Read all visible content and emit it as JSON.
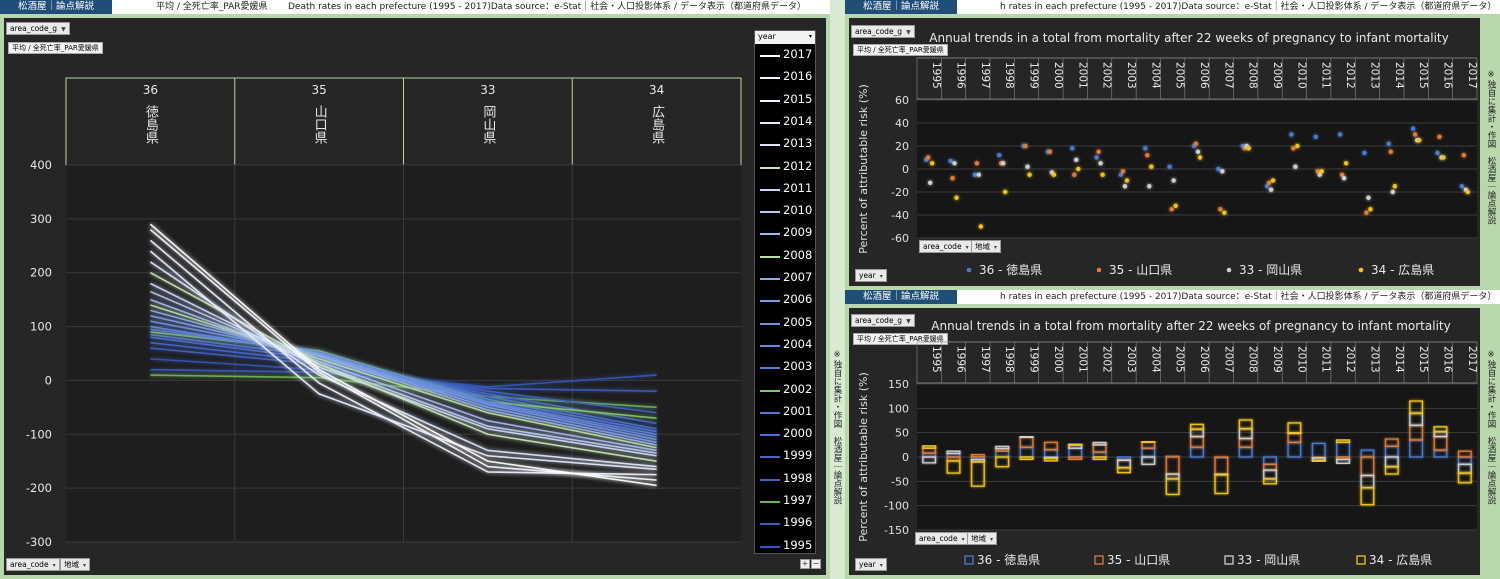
{
  "left": {
    "brand": "松酒屋｜論点解説",
    "crumb1": "平均 / 全死亡率_PAR愛媛県",
    "crumb2": "Death rates in each prefecture (1995 - 2017)Data source：e-Stat｜社会・人口投影体系 / データ表示（都道府県データ）",
    "filter_label": "area_code_g",
    "subtitle": "平均 / 全死亡率_PAR愛媛県",
    "legend_title": "year",
    "bottom_left": "area_code",
    "bottom_mid": "地域",
    "side_note": "※独自に集計・作図　松酒屋｜論点解説",
    "plus": "+",
    "minus": "−"
  },
  "right_top": {
    "brand": "松酒屋｜論点解説",
    "crumb": "h rates in each prefecture (1995 - 2017)Data source：e-Stat｜社会・人口投影体系 / データ表示（都道府県データ）",
    "filter_label": "area_code_g",
    "subtitle": "平均 / 全死亡率_PAR愛媛県",
    "area_code": "area_code",
    "area_region": "地域",
    "year_chip": "year",
    "side_note": "※独自に集計・作図　松酒屋｜論点解説"
  },
  "right_bottom": {
    "brand": "松酒屋｜論点解説",
    "crumb": "h rates in each prefecture (1995 - 2017)Data source：e-Stat｜社会・人口投影体系 / データ表示（都道府県データ）",
    "filter_label": "area_code_g",
    "subtitle": "平均 / 全死亡率_PAR愛媛県",
    "area_code": "area_code",
    "area_region": "地域",
    "year_chip": "year",
    "side_note": "※独自に集計・作図　松酒屋｜論点解説"
  },
  "colors": {
    "tokushima": "#4a7bd0",
    "yamaguchi": "#e07b39",
    "okayama": "#cfcfcf",
    "hiroshima": "#f0c419"
  },
  "chart_data": [
    {
      "type": "line",
      "title": "",
      "categories": [
        "36\n徳島県",
        "35\n山口県",
        "33\n岡山県",
        "34\n広島県"
      ],
      "category_codes": [
        "36",
        "35",
        "33",
        "34"
      ],
      "category_names": [
        "徳島県",
        "山口県",
        "岡山県",
        "広島県"
      ],
      "ylim": [
        -300,
        400
      ],
      "yticks": [
        -300,
        -200,
        -100,
        0,
        100,
        200,
        300,
        400
      ],
      "legend_position": "right",
      "legend_title": "year",
      "series": [
        {
          "name": "2017",
          "color": "#ffffff",
          "values": [
            290,
            20,
            -150,
            -195
          ]
        },
        {
          "name": "2016",
          "color": "#f4f7ff",
          "values": [
            280,
            15,
            -160,
            -185
          ]
        },
        {
          "name": "2015",
          "color": "#eef2ff",
          "values": [
            260,
            -5,
            -170,
            -175
          ]
        },
        {
          "name": "2014",
          "color": "#e6ecff",
          "values": [
            240,
            -25,
            -140,
            -165
          ]
        },
        {
          "name": "2013",
          "color": "#dde5fb",
          "values": [
            220,
            10,
            -130,
            -160
          ]
        },
        {
          "name": "2012",
          "color": "#c6e6b6",
          "values": [
            200,
            30,
            -100,
            -150
          ]
        },
        {
          "name": "2011",
          "color": "#cbd7f6",
          "values": [
            180,
            25,
            -90,
            -140
          ]
        },
        {
          "name": "2010",
          "color": "#b7c8f2",
          "values": [
            165,
            30,
            -85,
            -135
          ]
        },
        {
          "name": "2009",
          "color": "#a3b9ee",
          "values": [
            150,
            35,
            -75,
            -130
          ]
        },
        {
          "name": "2008",
          "color": "#b8df9f",
          "values": [
            140,
            40,
            -60,
            -125
          ]
        },
        {
          "name": "2007",
          "color": "#8ea9ea",
          "values": [
            130,
            45,
            -55,
            -120
          ]
        },
        {
          "name": "2006",
          "color": "#7f9de6",
          "values": [
            120,
            48,
            -50,
            -115
          ]
        },
        {
          "name": "2005",
          "color": "#6f91e2",
          "values": [
            110,
            50,
            -45,
            -110
          ]
        },
        {
          "name": "2004",
          "color": "#6488de",
          "values": [
            100,
            50,
            -42,
            -105
          ]
        },
        {
          "name": "2003",
          "color": "#5b80da",
          "values": [
            95,
            52,
            -40,
            -100
          ]
        },
        {
          "name": "2002",
          "color": "#86c66a",
          "values": [
            90,
            55,
            -40,
            -70
          ]
        },
        {
          "name": "2001",
          "color": "#5278d4",
          "values": [
            85,
            45,
            -35,
            -95
          ]
        },
        {
          "name": "2000",
          "color": "#4a70cf",
          "values": [
            80,
            40,
            -30,
            -90
          ]
        },
        {
          "name": "1999",
          "color": "#4469c9",
          "values": [
            70,
            35,
            -25,
            -80
          ]
        },
        {
          "name": "1998",
          "color": "#3f63c4",
          "values": [
            60,
            30,
            -20,
            -60
          ]
        },
        {
          "name": "1997",
          "color": "#6fb556",
          "values": [
            10,
            5,
            -30,
            -50
          ]
        },
        {
          "name": "1996",
          "color": "#3a5cbd",
          "values": [
            20,
            15,
            -15,
            -20
          ]
        },
        {
          "name": "1995",
          "color": "#3556b6",
          "values": [
            40,
            20,
            -12,
            10
          ]
        }
      ]
    },
    {
      "type": "scatter",
      "title": "Annual trends in a total from mortality after 22 weeks of pregnancy to infant mortality",
      "ylabel": "Percent of attributable risk (%)",
      "x": [
        "1995",
        "1996",
        "1997",
        "1998",
        "1999",
        "2000",
        "2001",
        "2002",
        "2003",
        "2004",
        "2005",
        "2006",
        "2007",
        "2008",
        "2009",
        "2010",
        "2011",
        "2012",
        "2013",
        "2014",
        "2015",
        "2016",
        "2017"
      ],
      "ylim": [
        -60,
        60
      ],
      "yticks": [
        -60,
        -40,
        -20,
        0,
        20,
        40,
        60
      ],
      "legend_position": "bottom",
      "series": [
        {
          "name": "36 - 徳島県",
          "values": [
            8,
            7,
            -5,
            12,
            20,
            15,
            18,
            10,
            -5,
            18,
            2,
            20,
            0,
            20,
            -15,
            30,
            28,
            30,
            14,
            22,
            35,
            14,
            -15
          ]
        },
        {
          "name": "35 - 山口県",
          "values": [
            10,
            -8,
            5,
            5,
            20,
            15,
            -5,
            15,
            -2,
            12,
            -35,
            22,
            -35,
            18,
            -12,
            18,
            -2,
            -5,
            -38,
            15,
            30,
            28,
            12
          ]
        },
        {
          "name": "33 - 岡山県",
          "values": [
            -12,
            5,
            -5,
            5,
            2,
            -3,
            8,
            5,
            -15,
            -15,
            -10,
            15,
            -2,
            20,
            -18,
            2,
            -5,
            -8,
            -25,
            -20,
            25,
            10,
            -18
          ]
        },
        {
          "name": "34 - 広島県",
          "values": [
            5,
            -25,
            -50,
            -20,
            -5,
            -5,
            0,
            -5,
            -10,
            2,
            -32,
            10,
            -38,
            18,
            -10,
            20,
            -2,
            5,
            -35,
            -15,
            25,
            10,
            -20
          ]
        }
      ]
    },
    {
      "type": "bar",
      "title": "Annual trends in a total from mortality after 22 weeks of pregnancy to infant mortality",
      "ylabel": "Percent of attributable risk (%)",
      "x": [
        "1995",
        "1996",
        "1997",
        "1998",
        "1999",
        "2000",
        "2001",
        "2002",
        "2003",
        "2004",
        "2005",
        "2006",
        "2007",
        "2008",
        "2009",
        "2010",
        "2011",
        "2012",
        "2013",
        "2014",
        "2015",
        "2016",
        "2017"
      ],
      "ylim": [
        -150,
        150
      ],
      "yticks": [
        -150,
        -100,
        -50,
        0,
        50,
        100,
        150
      ],
      "legend_position": "bottom",
      "stacked": true,
      "series": [
        {
          "name": "36 - 徳島県",
          "values": [
            8,
            7,
            -5,
            12,
            20,
            15,
            18,
            10,
            -5,
            18,
            2,
            20,
            0,
            20,
            -15,
            30,
            28,
            30,
            14,
            22,
            35,
            14,
            -15
          ]
        },
        {
          "name": "35 - 山口県",
          "values": [
            10,
            -8,
            5,
            5,
            20,
            15,
            -5,
            15,
            -2,
            12,
            -35,
            22,
            -35,
            18,
            -12,
            18,
            -2,
            -5,
            -38,
            15,
            30,
            28,
            12
          ]
        },
        {
          "name": "33 - 岡山県",
          "values": [
            -12,
            5,
            -5,
            5,
            2,
            -3,
            8,
            5,
            -15,
            -15,
            -10,
            15,
            -2,
            20,
            -18,
            2,
            -5,
            -8,
            -25,
            -20,
            25,
            10,
            -18
          ]
        },
        {
          "name": "34 - 広島県",
          "values": [
            5,
            -25,
            -50,
            -20,
            -5,
            -5,
            0,
            -5,
            -10,
            2,
            -32,
            10,
            -38,
            18,
            -10,
            20,
            -2,
            5,
            -35,
            -15,
            25,
            10,
            -20
          ]
        }
      ]
    }
  ]
}
